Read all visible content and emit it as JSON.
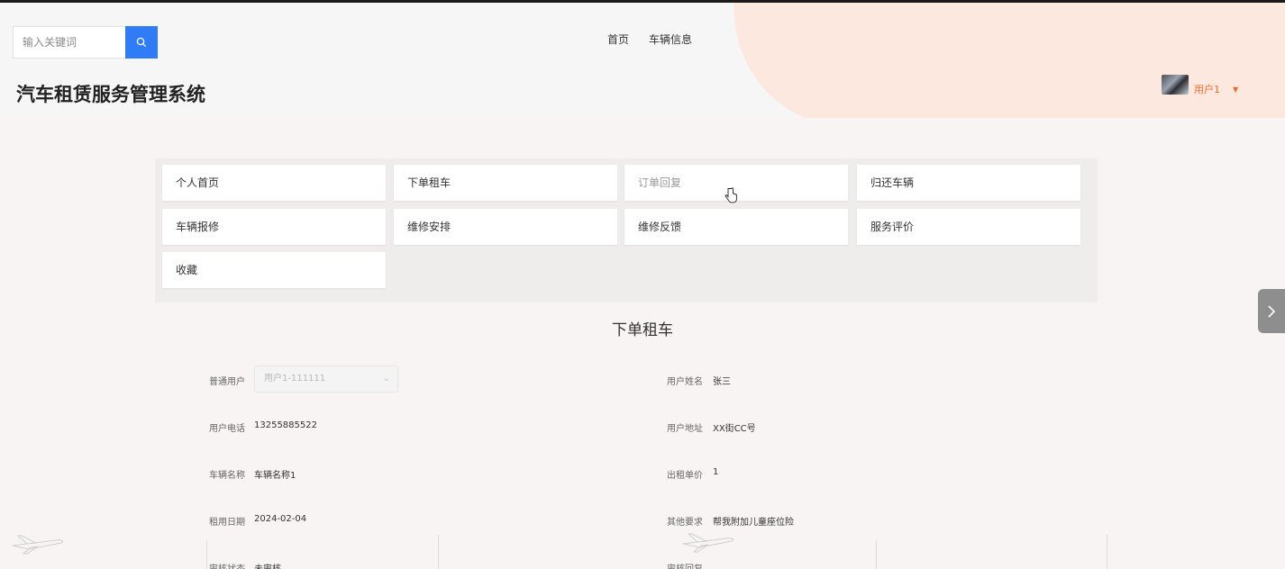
{
  "header": {
    "search_placeholder": "输入关键词",
    "nav": [
      "首页",
      "车辆信息"
    ],
    "site_title": "汽车租赁服务管理系统",
    "username": "用户1"
  },
  "menu": [
    {
      "label": "个人首页"
    },
    {
      "label": "下单租车"
    },
    {
      "label": "订单回复"
    },
    {
      "label": "归还车辆"
    },
    {
      "label": "车辆报修"
    },
    {
      "label": "维修安排"
    },
    {
      "label": "维修反馈"
    },
    {
      "label": "服务评价"
    },
    {
      "label": "收藏"
    }
  ],
  "form": {
    "title": "下单租车",
    "user_type_label": "普通用户",
    "user_type_value": "用户1-111111",
    "name_label": "用户姓名",
    "name_value": "张三",
    "phone_label": "用户电话",
    "phone_value": "13255885522",
    "address_label": "用户地址",
    "address_value": "XX街CC号",
    "car_name_label": "车辆名称",
    "car_name_value": "车辆名称1",
    "price_label": "出租单价",
    "price_value": "1",
    "date_label": "租用日期",
    "date_value": "2024-02-04",
    "other_label": "其他要求",
    "other_value": "帮我附加儿童座位险",
    "status_label": "审核状态",
    "status_value": "未审核",
    "reply_label": "审核回复"
  },
  "colors": {
    "accent": "#2f7cf6",
    "user_orange": "#f06a2b"
  }
}
